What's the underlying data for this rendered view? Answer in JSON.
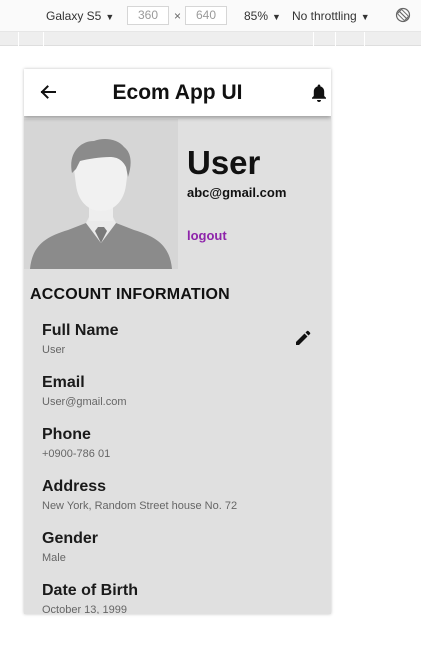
{
  "devtools": {
    "device": "Galaxy S5",
    "width": "360",
    "height": "640",
    "times": "×",
    "zoom": "85%",
    "throttle": "No throttling",
    "caret": "▼"
  },
  "app": {
    "title": "Ecom App UI",
    "back_icon": "arrow-left-icon",
    "bell_icon": "bell-icon"
  },
  "profile": {
    "name": "User",
    "email": "abc@gmail.com",
    "logout_label": "logout",
    "avatar_icon": "user-silhouette-icon"
  },
  "account": {
    "section_title": "ACCOUNT INFORMATION",
    "edit_icon": "pencil-icon",
    "items": [
      {
        "label": "Full Name",
        "value": "User"
      },
      {
        "label": "Email",
        "value": "User@gmail.com"
      },
      {
        "label": "Phone",
        "value": "+0900-786 01"
      },
      {
        "label": "Address",
        "value": "New York, Random Street house No. 72"
      },
      {
        "label": "Gender",
        "value": "Male"
      },
      {
        "label": "Date of Birth",
        "value": "October 13, 1999"
      }
    ]
  },
  "colors": {
    "logout": "#8e24aa",
    "background": "#e0e0e0",
    "appbar": "#ffffff"
  }
}
